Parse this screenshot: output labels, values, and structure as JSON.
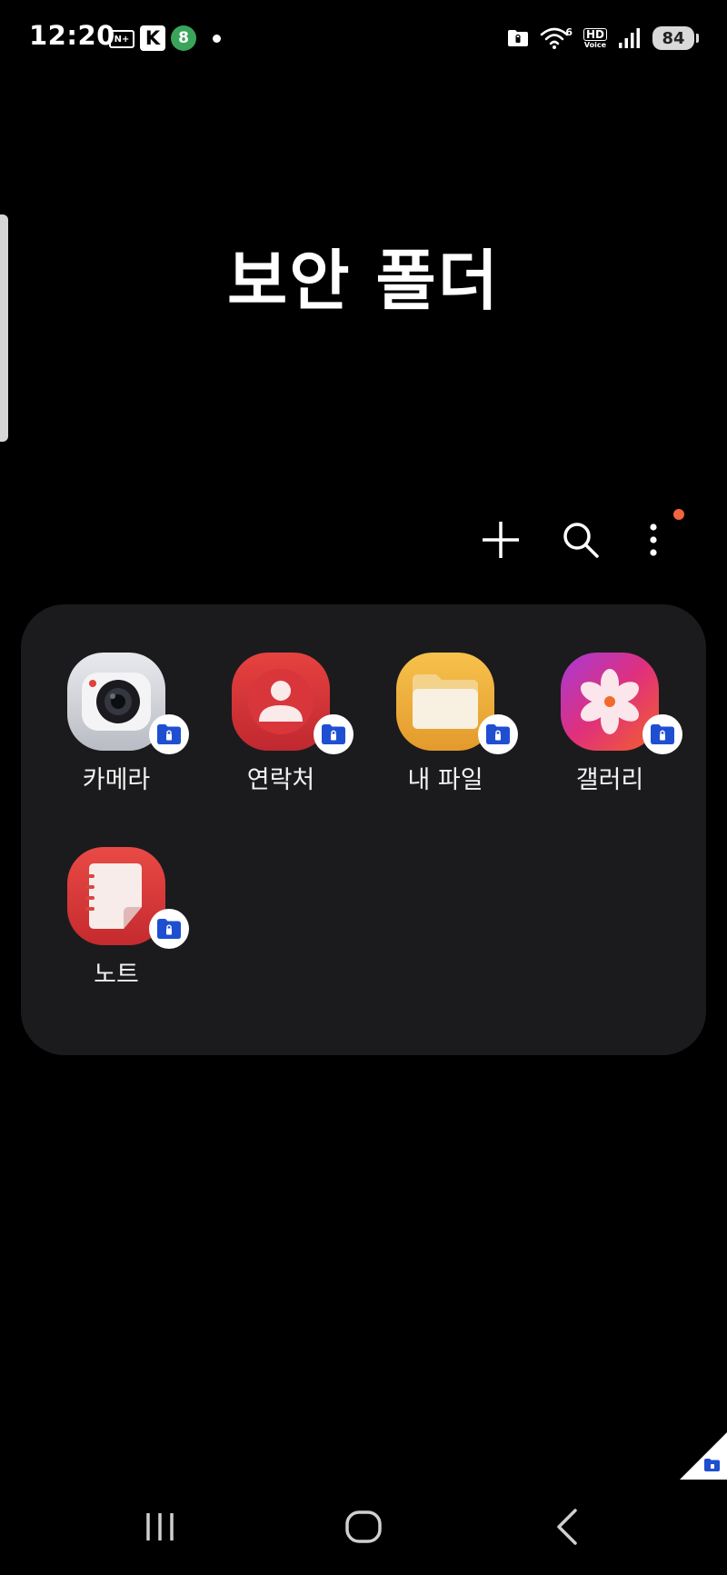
{
  "status_bar": {
    "time": "12:20",
    "badge_n": "N+",
    "badge_k": "K",
    "badge_green": "8",
    "hd": "HD",
    "voice": "Voice",
    "wifi_band": "6",
    "battery": "84"
  },
  "header": {
    "title": "보안 폴더"
  },
  "toolbar": {
    "add_icon": "plus-icon",
    "search_icon": "search-icon",
    "more_icon": "more-vert-icon",
    "update_dot_color": "#f0653b"
  },
  "apps": [
    {
      "label": "카메라",
      "icon": "camera-icon"
    },
    {
      "label": "연락처",
      "icon": "contacts-icon"
    },
    {
      "label": "내 파일",
      "icon": "my-files-icon"
    },
    {
      "label": "갤러리",
      "icon": "gallery-icon"
    },
    {
      "label": "노트",
      "icon": "notes-icon"
    }
  ],
  "colors": {
    "background": "#000000",
    "card": "#1b1b1d",
    "lock_badge": "#1f4fd1",
    "camera": "#d8dadf",
    "contacts": "#d8333a",
    "files": "#f0b23c",
    "gallery": "#d92f86",
    "notes": "#d93434"
  },
  "nav": {
    "recents_icon": "recents-icon",
    "home_icon": "home-icon",
    "back_icon": "back-icon"
  }
}
